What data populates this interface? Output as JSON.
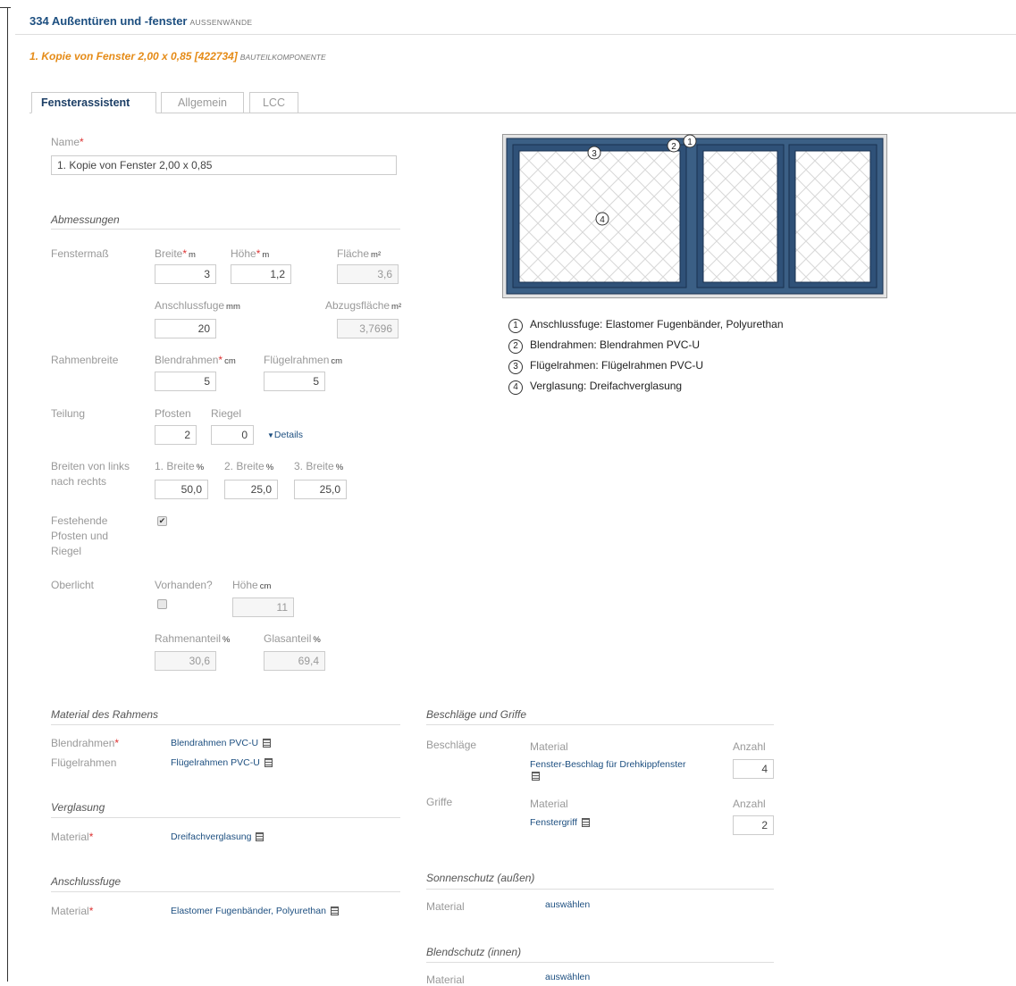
{
  "header": {
    "title": "334 Außentüren und -fenster",
    "title_tag": "AUSSENWÄNDE",
    "subtitle": "1. Kopie von Fenster 2,00 x 0,85 [422734]",
    "subtitle_tag": "BAUTEILKOMPONENTE"
  },
  "tabs": [
    {
      "label": "Fensterassistent",
      "active": true
    },
    {
      "label": "Allgemein",
      "active": false
    },
    {
      "label": "LCC",
      "active": false
    }
  ],
  "name": {
    "label": "Name",
    "value": "1. Kopie von Fenster 2,00 x 0,85"
  },
  "dimensions": {
    "section": "Abmessungen",
    "fenstermass_label": "Fenstermaß",
    "breite": {
      "label": "Breite",
      "unit": "m",
      "value": "3"
    },
    "hoehe": {
      "label": "Höhe",
      "unit": "m",
      "value": "1,2"
    },
    "flaeche": {
      "label": "Fläche",
      "unit": "m²",
      "value": "3,6"
    },
    "anschlussfuge": {
      "label": "Anschlussfuge",
      "unit": "mm",
      "value": "20"
    },
    "abzugsflaeche": {
      "label": "Abzugsfläche",
      "unit": "m²",
      "value": "3,7696"
    },
    "rahmenbreite_label": "Rahmenbreite",
    "blendrahmen": {
      "label": "Blendrahmen",
      "unit": "cm",
      "value": "5"
    },
    "fluegelrahmen": {
      "label": "Flügelrahmen",
      "unit": "cm",
      "value": "5"
    },
    "teilung_label": "Teilung",
    "pfosten": {
      "label": "Pfosten",
      "value": "2"
    },
    "riegel": {
      "label": "Riegel",
      "value": "0"
    },
    "details_link": "Details",
    "breiten_label_1": "Breiten von links",
    "breiten_label_2": "nach rechts",
    "breite1": {
      "label": "1. Breite",
      "unit": "%",
      "value": "50,0"
    },
    "breite2": {
      "label": "2. Breite",
      "unit": "%",
      "value": "25,0"
    },
    "breite3": {
      "label": "3. Breite",
      "unit": "%",
      "value": "25,0"
    },
    "festehende_label_1": "Festehende",
    "festehende_label_2": "Pfosten und",
    "festehende_label_3": "Riegel",
    "festehende_checked": true,
    "oberlicht_label": "Oberlicht",
    "vorhanden_label": "Vorhanden?",
    "vorhanden_checked": false,
    "oberlicht_hoehe": {
      "label": "Höhe",
      "unit": "cm",
      "value": "11"
    },
    "rahmenanteil": {
      "label": "Rahmenanteil",
      "unit": "%",
      "value": "30,6"
    },
    "glasanteil": {
      "label": "Glasanteil",
      "unit": "%",
      "value": "69,4"
    }
  },
  "legend": [
    {
      "num": "1",
      "text": "Anschlussfuge: Elastomer Fugenbänder, Polyurethan"
    },
    {
      "num": "2",
      "text": "Blendrahmen: Blendrahmen PVC-U"
    },
    {
      "num": "3",
      "text": "Flügelrahmen: Flügelrahmen PVC-U"
    },
    {
      "num": "4",
      "text": "Verglasung: Dreifachverglasung"
    }
  ],
  "material_rahmen": {
    "section": "Material des Rahmens",
    "blendrahmen_label": "Blendrahmen",
    "blendrahmen_value": "Blendrahmen PVC-U",
    "fluegelrahmen_label": "Flügelrahmen",
    "fluegelrahmen_value": "Flügelrahmen PVC-U"
  },
  "verglasung": {
    "section": "Verglasung",
    "label": "Material",
    "value": "Dreifachverglasung"
  },
  "anschlussfuge": {
    "section": "Anschlussfuge",
    "label": "Material",
    "value": "Elastomer Fugenbänder, Polyurethan"
  },
  "beschlaege": {
    "section": "Beschläge und Griffe",
    "beschlaege_label": "Beschläge",
    "material_label": "Material",
    "anzahl_label": "Anzahl",
    "beschlag_value": "Fenster-Beschlag für Drehkippfenster",
    "beschlag_anzahl": "4",
    "griffe_label": "Griffe",
    "griff_value": "Fenstergriff",
    "griff_anzahl": "2"
  },
  "sonnenschutz": {
    "section": "Sonnenschutz (außen)",
    "label": "Material",
    "link": "auswählen"
  },
  "blendschutz": {
    "section": "Blendschutz (innen)",
    "label": "Material",
    "link": "auswählen"
  },
  "colors": {
    "frame": "#3b5f85",
    "accent_orange": "#e58b17",
    "title_blue": "#1d4f80"
  }
}
